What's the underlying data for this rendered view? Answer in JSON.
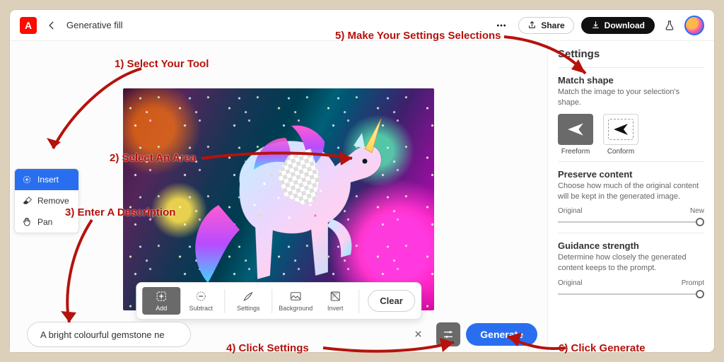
{
  "header": {
    "title": "Generative fill",
    "share_label": "Share",
    "download_label": "Download"
  },
  "tools": {
    "insert": "Insert",
    "remove": "Remove",
    "pan": "Pan"
  },
  "float_toolbar": {
    "add": "Add",
    "subtract": "Subtract",
    "settings": "Settings",
    "background": "Background",
    "invert": "Invert",
    "clear": "Clear"
  },
  "prompt": {
    "value": "A bright colourful gemstone necklace",
    "generate": "Generate"
  },
  "settings": {
    "heading": "Settings",
    "match_shape": {
      "title": "Match shape",
      "desc": "Match the image to your selection's shape.",
      "freeform": "Freeform",
      "conform": "Conform"
    },
    "preserve": {
      "title": "Preserve content",
      "desc": "Choose how much of the original content will be kept in the generated image.",
      "left": "Original",
      "right": "New"
    },
    "guidance": {
      "title": "Guidance strength",
      "desc": "Determine how closely the generated content keeps to the prompt.",
      "left": "Original",
      "right": "Prompt"
    }
  },
  "annotations": {
    "a1": "1) Select Your Tool",
    "a2": "2) Select An Area",
    "a3": "3) Enter A Description",
    "a4": "4) Click Settings",
    "a5": "5) Make Your Settings Selections",
    "a6": "6) Click Generate"
  }
}
